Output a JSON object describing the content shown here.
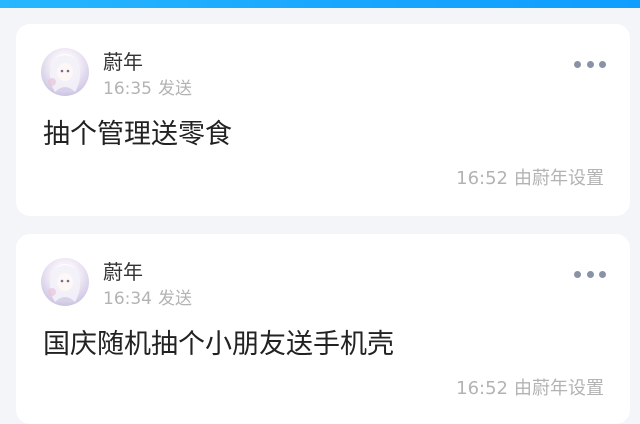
{
  "posts": [
    {
      "author": "蔚年",
      "time": "16:35",
      "action": "发送",
      "content": "抽个管理送零食",
      "footer_time": "16:52",
      "footer_text": "由蔚年设置"
    },
    {
      "author": "蔚年",
      "time": "16:34",
      "action": "发送",
      "content": "国庆随机抽个小朋友送手机壳",
      "footer_time": "16:52",
      "footer_text": "由蔚年设置"
    }
  ],
  "colors": {
    "top_bar": "#1aa7ff",
    "background": "#f4f5f8",
    "card": "#ffffff",
    "secondary_text": "#b3b3b3",
    "more_dots": "#8a93a6"
  },
  "icons": {
    "more": "more-horizontal-icon",
    "avatar": "anime-girl-avatar"
  }
}
